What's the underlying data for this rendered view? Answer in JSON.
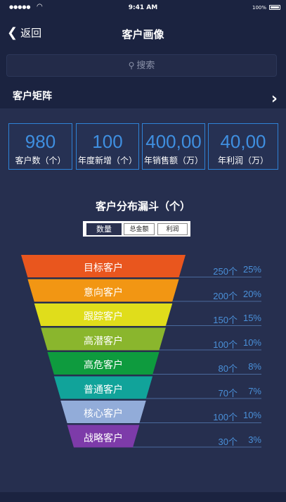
{
  "status_bar": {
    "signal": "●●●●●",
    "wifi": "wifi-icon",
    "time": "9:41 AM",
    "battery": "100%"
  },
  "nav": {
    "back_label": "返回",
    "title": "客户画像"
  },
  "search": {
    "placeholder": "搜索"
  },
  "matrix": {
    "title": "客户矩阵"
  },
  "stats": [
    {
      "value": "980",
      "label": "客户数（个）"
    },
    {
      "value": "100",
      "label": "年度新增（个）"
    },
    {
      "value": "400,00",
      "label": "年销售额（万）"
    },
    {
      "value": "40,00",
      "label": "年利润（万）"
    }
  ],
  "funnel": {
    "title": "客户分布漏斗（个）",
    "tabs": [
      {
        "label": "数量",
        "active": true
      },
      {
        "label": "总金额",
        "active": false
      },
      {
        "label": "利润",
        "active": false
      }
    ]
  },
  "chart_data": {
    "type": "funnel",
    "title": "客户分布漏斗（个）",
    "stages": [
      {
        "name": "目标客户",
        "count": 250,
        "percent": 25,
        "count_label": "250个",
        "percent_label": "25%",
        "color": "#e9561e"
      },
      {
        "name": "意向客户",
        "count": 200,
        "percent": 20,
        "count_label": "200个",
        "percent_label": "20%",
        "color": "#f29613"
      },
      {
        "name": "跟踪客户",
        "count": 150,
        "percent": 15,
        "count_label": "150个",
        "percent_label": "15%",
        "color": "#e0dd1b"
      },
      {
        "name": "高潜客户",
        "count": 100,
        "percent": 10,
        "count_label": "100个",
        "percent_label": "10%",
        "color": "#8ab62d"
      },
      {
        "name": "高危客户",
        "count": 80,
        "percent": 8,
        "count_label": "80个",
        "percent_label": "8%",
        "color": "#0e9b3e"
      },
      {
        "name": "普通客户",
        "count": 70,
        "percent": 7,
        "count_label": "70个",
        "percent_label": "7%",
        "color": "#11a39a"
      },
      {
        "name": "核心客户",
        "count": 100,
        "percent": 10,
        "count_label": "100个",
        "percent_label": "10%",
        "color": "#92acd9"
      },
      {
        "name": "战略客户",
        "count": 30,
        "percent": 3,
        "count_label": "30个",
        "percent_label": "3%",
        "color": "#7d3ba9"
      }
    ]
  }
}
